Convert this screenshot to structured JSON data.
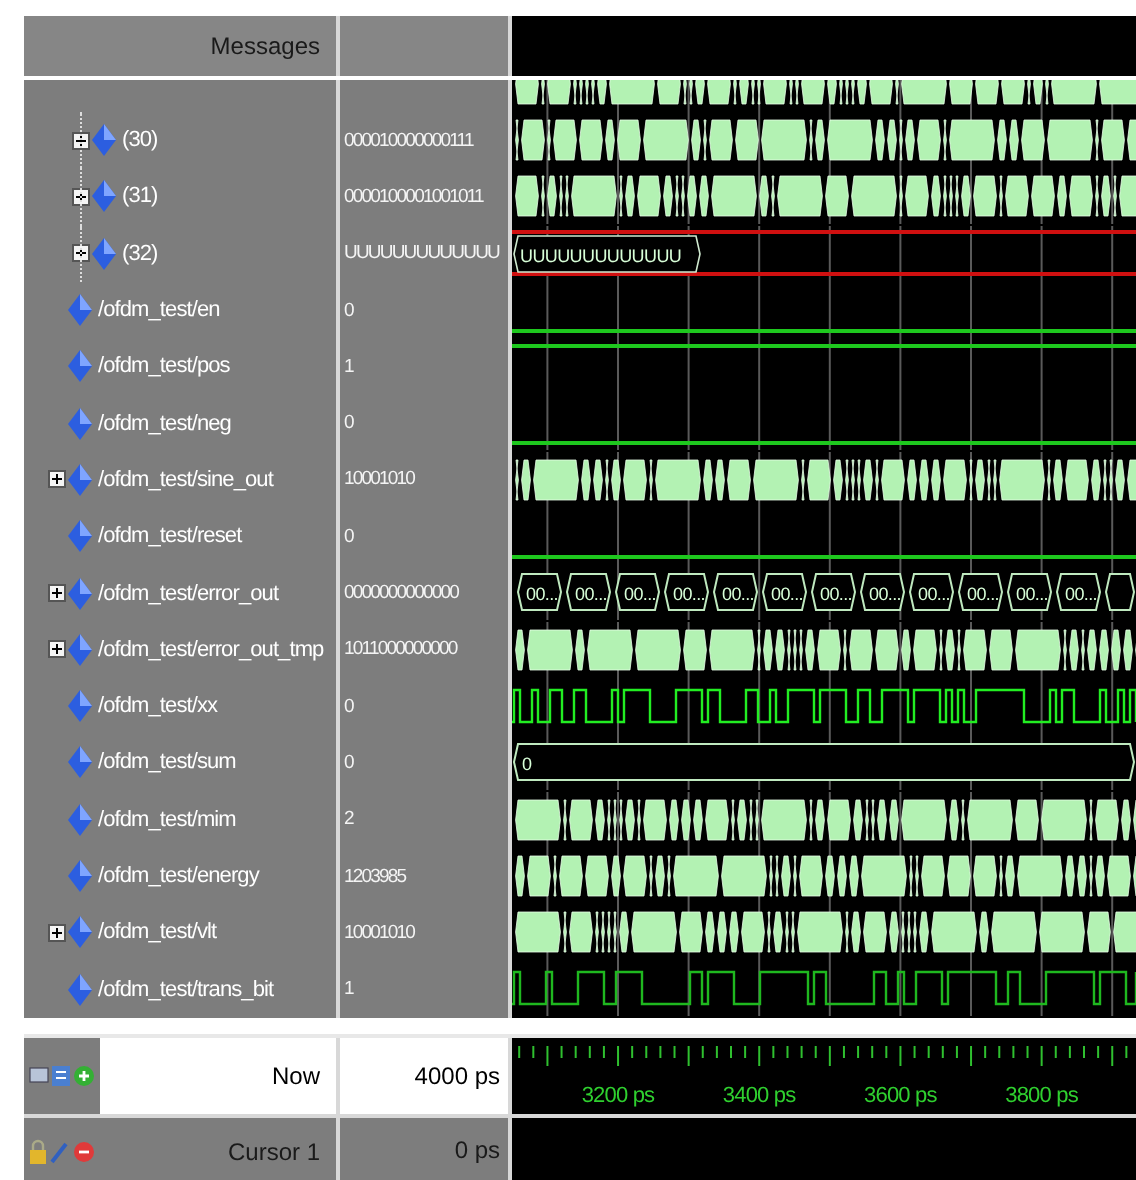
{
  "header": {
    "title": "Messages"
  },
  "signals": [
    {
      "children": [
        {
          "kind": "bus"
        },
        {
          "name": "(30)",
          "value": "000010000000111",
          "kind": "bus",
          "expandable": true
        },
        {
          "name": "(31)",
          "value": "0000100001001011",
          "kind": "bus",
          "expandable": true
        },
        {
          "name": "(32)",
          "value": "UUUUUUUUUUUUU",
          "kind": "undefined",
          "expandable": true,
          "wave_labels": [
            "UUUUUUUUUUUUU"
          ]
        }
      ]
    },
    {
      "name": "/ofdm_test/en",
      "value": "0",
      "kind": "low",
      "expandable": false
    },
    {
      "name": "/ofdm_test/pos",
      "value": "1",
      "kind": "high",
      "expandable": false
    },
    {
      "name": "/ofdm_test/neg",
      "value": "0",
      "kind": "low",
      "expandable": false
    },
    {
      "name": "/ofdm_test/sine_out",
      "value": "10001010",
      "kind": "bus",
      "expandable": true
    },
    {
      "name": "/ofdm_test/reset",
      "value": "0",
      "kind": "low",
      "expandable": false
    },
    {
      "name": "/ofdm_test/error_out",
      "value": "0000000000000",
      "kind": "labeled",
      "expandable": true,
      "wave_labels": [
        "00...",
        "00...",
        "00...",
        "00...",
        "00...",
        "00...",
        "00...",
        "00...",
        "00...",
        "00...",
        "00...",
        "00..."
      ]
    },
    {
      "name": "/ofdm_test/error_out_tmp",
      "value": "1011000000000",
      "kind": "bus",
      "expandable": true
    },
    {
      "name": "/ofdm_test/xx",
      "value": "0",
      "kind": "clock",
      "expandable": false
    },
    {
      "name": "/ofdm_test/sum",
      "value": "0",
      "kind": "labeled",
      "expandable": false,
      "wave_labels": [
        "0"
      ]
    },
    {
      "name": "/ofdm_test/mim",
      "value": "2",
      "kind": "bus",
      "expandable": false
    },
    {
      "name": "/ofdm_test/energy",
      "value": "1203985",
      "kind": "bus",
      "expandable": false
    },
    {
      "name": "/ofdm_test/vlt",
      "value": "10001010",
      "kind": "bus",
      "expandable": true
    },
    {
      "name": "/ofdm_test/trans_bit",
      "value": "1",
      "kind": "clock",
      "expandable": false
    }
  ],
  "footer": {
    "now_label": "Now",
    "now_value": "4000 ps",
    "cursor_label": "Cursor 1",
    "cursor_value": "0 ps",
    "time_labels": [
      "3200 ps",
      "3400 ps",
      "3600 ps",
      "3800 ps"
    ]
  }
}
